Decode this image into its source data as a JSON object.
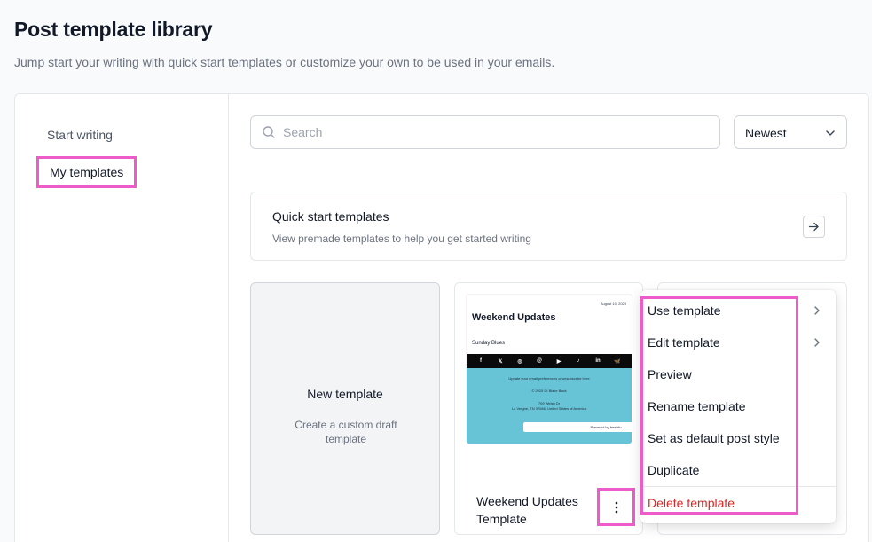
{
  "page": {
    "title": "Post template library",
    "subtitle": "Jump start your writing with quick start templates or customize your own to be used in your emails."
  },
  "sidebar": {
    "items": [
      {
        "label": "Start writing"
      },
      {
        "label": "My templates"
      }
    ]
  },
  "search": {
    "placeholder": "Search"
  },
  "sort": {
    "selected": "Newest"
  },
  "quick_start": {
    "title": "Quick start templates",
    "subtitle": "View premade templates to help you get started writing"
  },
  "new_template": {
    "title": "New template",
    "subtitle": "Create a custom draft template"
  },
  "template_card": {
    "name": "Weekend Updates Template",
    "thumbnail": {
      "date": "August 10, 2025",
      "title": "Weekend Updates",
      "subtitle": "Sunday Blues",
      "social": [
        "f",
        "𝕏",
        "◎",
        "@",
        "▶",
        "♪",
        "in",
        "🦋"
      ],
      "footer_line1": "Update your email preferences or unsubscribe here",
      "footer_line2": "© 2025 DI Blake Buck",
      "footer_line3": "709 Welsh Dr",
      "footer_line4": "La Vergne, TN 37086, United States of America",
      "powered": "Powered by beehiiv"
    }
  },
  "context_menu": {
    "items": [
      {
        "label": "Use template"
      },
      {
        "label": "Edit template"
      },
      {
        "label": "Preview"
      },
      {
        "label": "Rename template"
      },
      {
        "label": "Set as default post style"
      },
      {
        "label": "Duplicate"
      },
      {
        "label": "Delete template"
      }
    ]
  },
  "colors": {
    "highlight": "#ee5cc9",
    "danger": "#dc2626",
    "thumb_footer": "#67c3d6"
  }
}
